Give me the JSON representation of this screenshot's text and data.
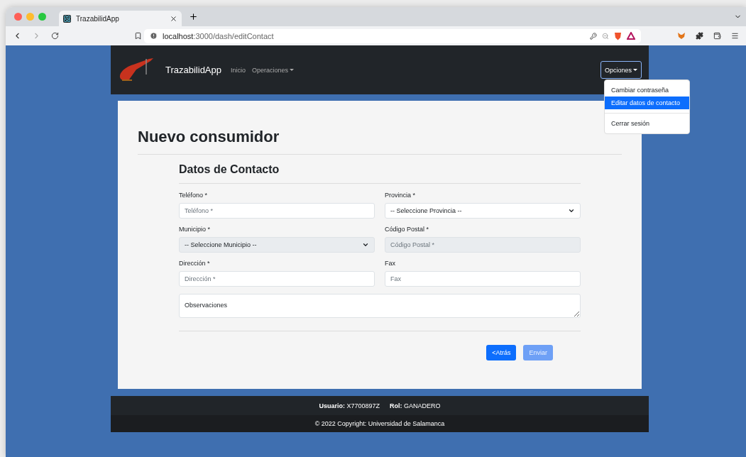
{
  "browser": {
    "tab_title": "TrazabilidApp",
    "url_host": "localhost",
    "url_path": ":3000/dash/editContact"
  },
  "navbar": {
    "brand": "TrazabilidApp",
    "links": [
      {
        "label": "Inicio",
        "dropdown": false
      },
      {
        "label": "Operaciones",
        "dropdown": true
      }
    ],
    "options_button": "Opciones",
    "menu": [
      {
        "label": "Cambiar contraseña",
        "selected": false,
        "divider_before": false
      },
      {
        "label": "Editar datos de contacto",
        "selected": true,
        "divider_before": false
      },
      {
        "label": "Cerrar sesión",
        "selected": false,
        "divider_before": true
      }
    ]
  },
  "form": {
    "title": "Nuevo consumidor",
    "section": "Datos de Contacto",
    "fields": [
      {
        "kind": "input",
        "label": "Teléfono *",
        "placeholder": "Teléfono *",
        "disabled": false
      },
      {
        "kind": "select",
        "label": "Provincia *",
        "value": "-- Seleccione Provincia --",
        "disabled": false
      },
      {
        "kind": "select",
        "label": "Municipio *",
        "value": "-- Seleccione Municipio --",
        "disabled": true
      },
      {
        "kind": "input",
        "label": "Código Postal *",
        "placeholder": "Código Postal *",
        "disabled": true
      },
      {
        "kind": "input",
        "label": "Dirección *",
        "placeholder": "Dirección *",
        "disabled": false
      },
      {
        "kind": "input",
        "label": "Fax",
        "placeholder": "Fax",
        "disabled": false
      },
      {
        "kind": "textarea",
        "placeholder": "Observaciones"
      }
    ],
    "buttons": [
      {
        "label": "<Atrás",
        "disabled": false
      },
      {
        "label": "Enviar",
        "disabled": true
      }
    ]
  },
  "footer": {
    "user": "**Usuario:** X7700897Z",
    "role": "**Rol:** GANADERO",
    "copyright": "© 2022 Copyright: Universidad de Salamanca"
  }
}
